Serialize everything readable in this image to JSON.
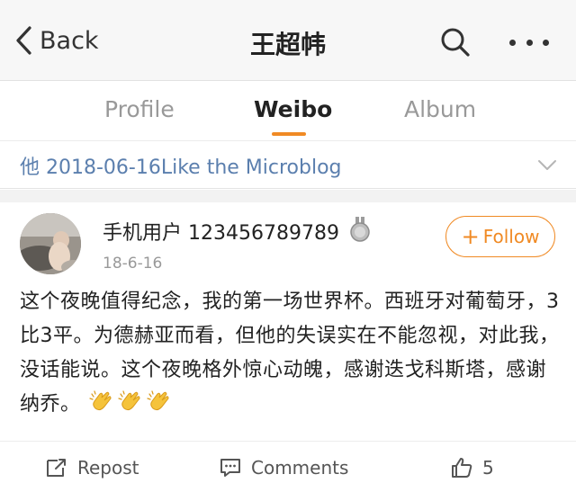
{
  "nav": {
    "back_label": "Back",
    "title": "王超帏"
  },
  "tabs": [
    {
      "label": "Profile",
      "active": false
    },
    {
      "label": "Weibo",
      "active": true
    },
    {
      "label": "Album",
      "active": false
    }
  ],
  "filter": {
    "text": "他 2018-06-16Like the Microblog"
  },
  "post": {
    "username": "手机用户 123456789789",
    "time": "18-6-16",
    "follow_label": "Follow",
    "text": "这个夜晚值得纪念，我的第一场世界杯。西班牙对葡萄牙，3比3平。为德赫亚而看，但他的失误实在不能忽视，对此我，没话能说。这个夜晚格外惊心动魄，感谢迭戈科斯塔，感谢纳乔。",
    "emoji": [
      "clapping-hands",
      "clapping-hands",
      "clapping-hands"
    ],
    "actions": {
      "repost": "Repost",
      "comments": "Comments",
      "likes": "5"
    }
  },
  "colors": {
    "accent": "#f08a24",
    "link": "#5b7fae"
  }
}
